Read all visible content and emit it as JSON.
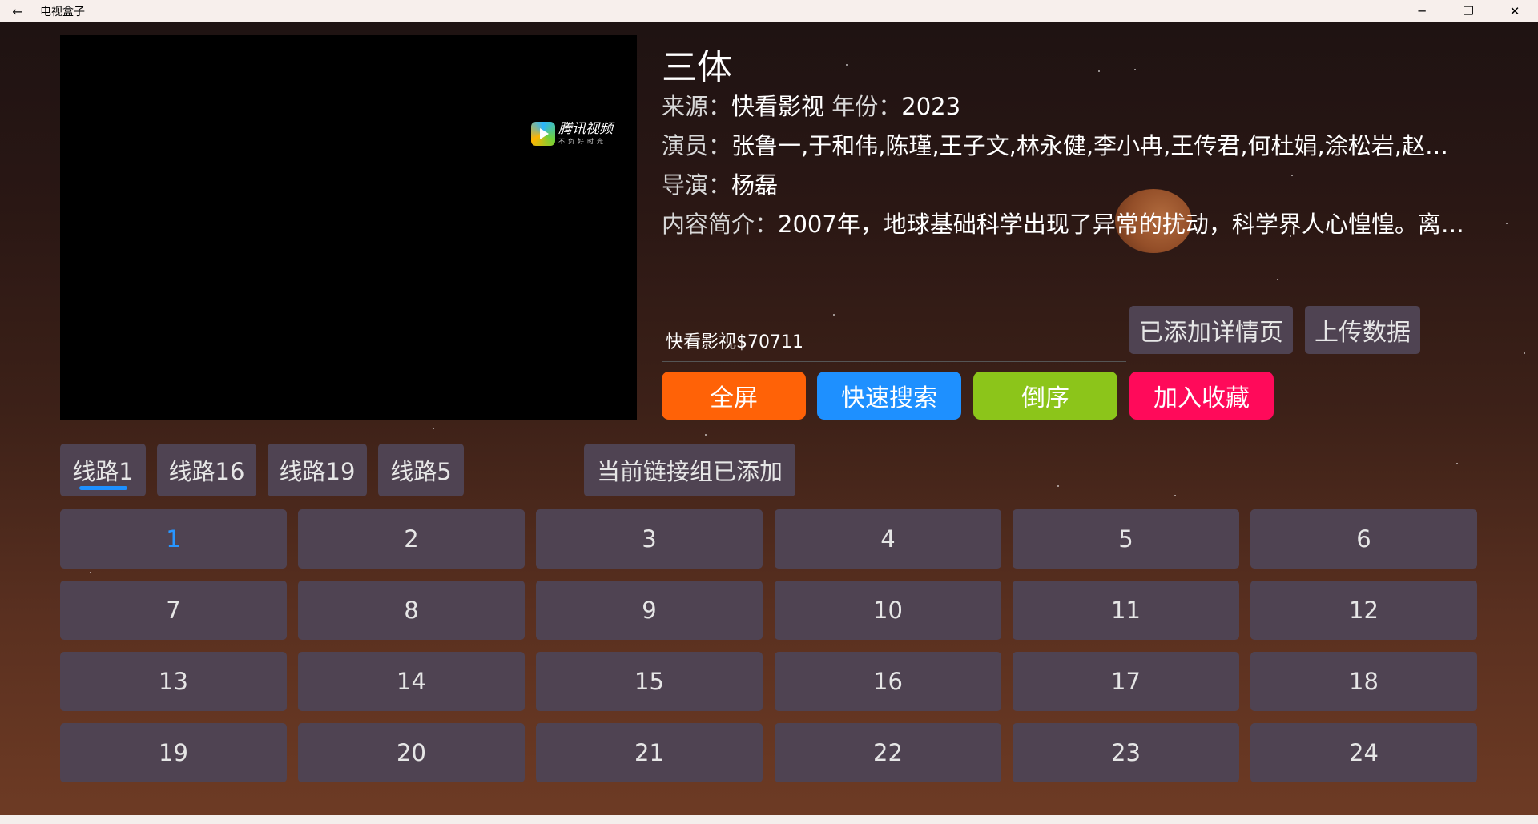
{
  "window": {
    "title": "电视盒子",
    "back_icon": "arrow-left-icon",
    "min_icon": "minimize-icon",
    "max_icon": "restore-icon",
    "close_icon": "close-icon"
  },
  "player": {
    "logo_name": "腾讯视频",
    "logo_sub": "不负好时光"
  },
  "details": {
    "title": "三体",
    "source_label": "来源：",
    "source_value": "快看影视",
    "year_label": "年份：",
    "year_value": "2023",
    "actors_label": "演员：",
    "actors_value": "张鲁一,于和伟,陈瑾,王子文,林永健,李小冉,王传君,何杜娟,涂松岩,赵…",
    "director_label": "导演：",
    "director_value": "杨磊",
    "summary_label": "内容简介：",
    "summary_value": "2007年，地球基础科学出现了异常的扰动，科学界人心惶惶。离…"
  },
  "link_field": {
    "value": "快看影视$70711"
  },
  "action_buttons": {
    "added_detail": "已添加详情页",
    "upload_data": "上传数据",
    "fullscreen": "全屏",
    "quick_search": "快速搜索",
    "reverse": "倒序",
    "add_favorite": "加入收藏"
  },
  "colors": {
    "fullscreen": "#ff6207",
    "quick_search": "#1e90ff",
    "reverse": "#8cc51a",
    "add_favorite": "#ff0a5a",
    "active_tab_indicator": "#1e90ff"
  },
  "routes": {
    "tabs": [
      "线路1",
      "线路16",
      "线路19",
      "线路5"
    ],
    "active_index": 0,
    "group_status": "当前链接组已添加"
  },
  "episodes": {
    "items": [
      "1",
      "2",
      "3",
      "4",
      "5",
      "6",
      "7",
      "8",
      "9",
      "10",
      "11",
      "12",
      "13",
      "14",
      "15",
      "16",
      "17",
      "18",
      "19",
      "20",
      "21",
      "22",
      "23",
      "24"
    ],
    "active_index": 0
  }
}
